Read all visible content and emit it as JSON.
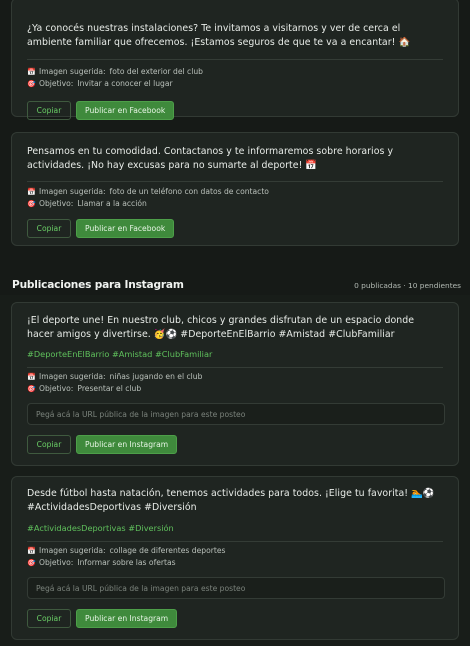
{
  "facebook_posts": [
    {
      "text": "¿Ya conocés nuestras instalaciones? Te invitamos a visitarnos y ver de cerca el ambiente familiar que ofrecemos. ¡Estamos seguros de que te va a encantar! 🏠",
      "image_label": "Imagen sugerida:",
      "image_value": "foto del exterior del club",
      "goal_label": "Objetivo:",
      "goal_value": "Invitar a conocer el lugar",
      "copy_label": "Copiar",
      "publish_label": "Publicar en Facebook"
    },
    {
      "text": "Pensamos en tu comodidad. Contactanos y te informaremos sobre horarios y actividades. ¡No hay excusas para no sumarte al deporte! 📅",
      "image_label": "Imagen sugerida:",
      "image_value": "foto de un teléfono con datos de contacto",
      "goal_label": "Objetivo:",
      "goal_value": "Llamar a la acción",
      "copy_label": "Copiar",
      "publish_label": "Publicar en Facebook"
    }
  ],
  "instagram_section": {
    "title": "Publicaciones para Instagram",
    "count": "0 publicadas · 10 pendientes"
  },
  "instagram_posts": [
    {
      "text": "¡El deporte une! En nuestro club, chicos y grandes disfrutan de un espacio donde hacer amigos y divertirse. 🥳⚽ #DeporteEnElBarrio #Amistad #ClubFamiliar",
      "hashtags": "#DeporteEnElBarrio #Amistad #ClubFamiliar",
      "image_label": "Imagen sugerida:",
      "image_value": "niñas jugando en el club",
      "goal_label": "Objetivo:",
      "goal_value": "Presentar el club",
      "url_placeholder": "Pegá acá la URL pública de la imagen para este posteo",
      "copy_label": "Copiar",
      "publish_label": "Publicar en Instagram"
    },
    {
      "text": "Desde fútbol hasta natación, tenemos actividades para todos. ¡Elige tu favorita! 🏊⚽ #ActividadesDeportivas #Diversión",
      "hashtags": "#ActividadesDeportivas #Diversión",
      "image_label": "Imagen sugerida:",
      "image_value": "collage de diferentes deportes",
      "goal_label": "Objetivo:",
      "goal_value": "Informar sobre las ofertas",
      "url_placeholder": "Pegá acá la URL pública de la imagen para este posteo",
      "copy_label": "Copiar",
      "publish_label": "Publicar en Instagram"
    }
  ],
  "icons": {
    "image": "calendar-icon",
    "goal": "target-icon"
  },
  "colors": {
    "background": "#161a17",
    "card": "#1f2521",
    "accent_green": "#3f8a3c",
    "hashtag_green": "#5fc05c"
  }
}
